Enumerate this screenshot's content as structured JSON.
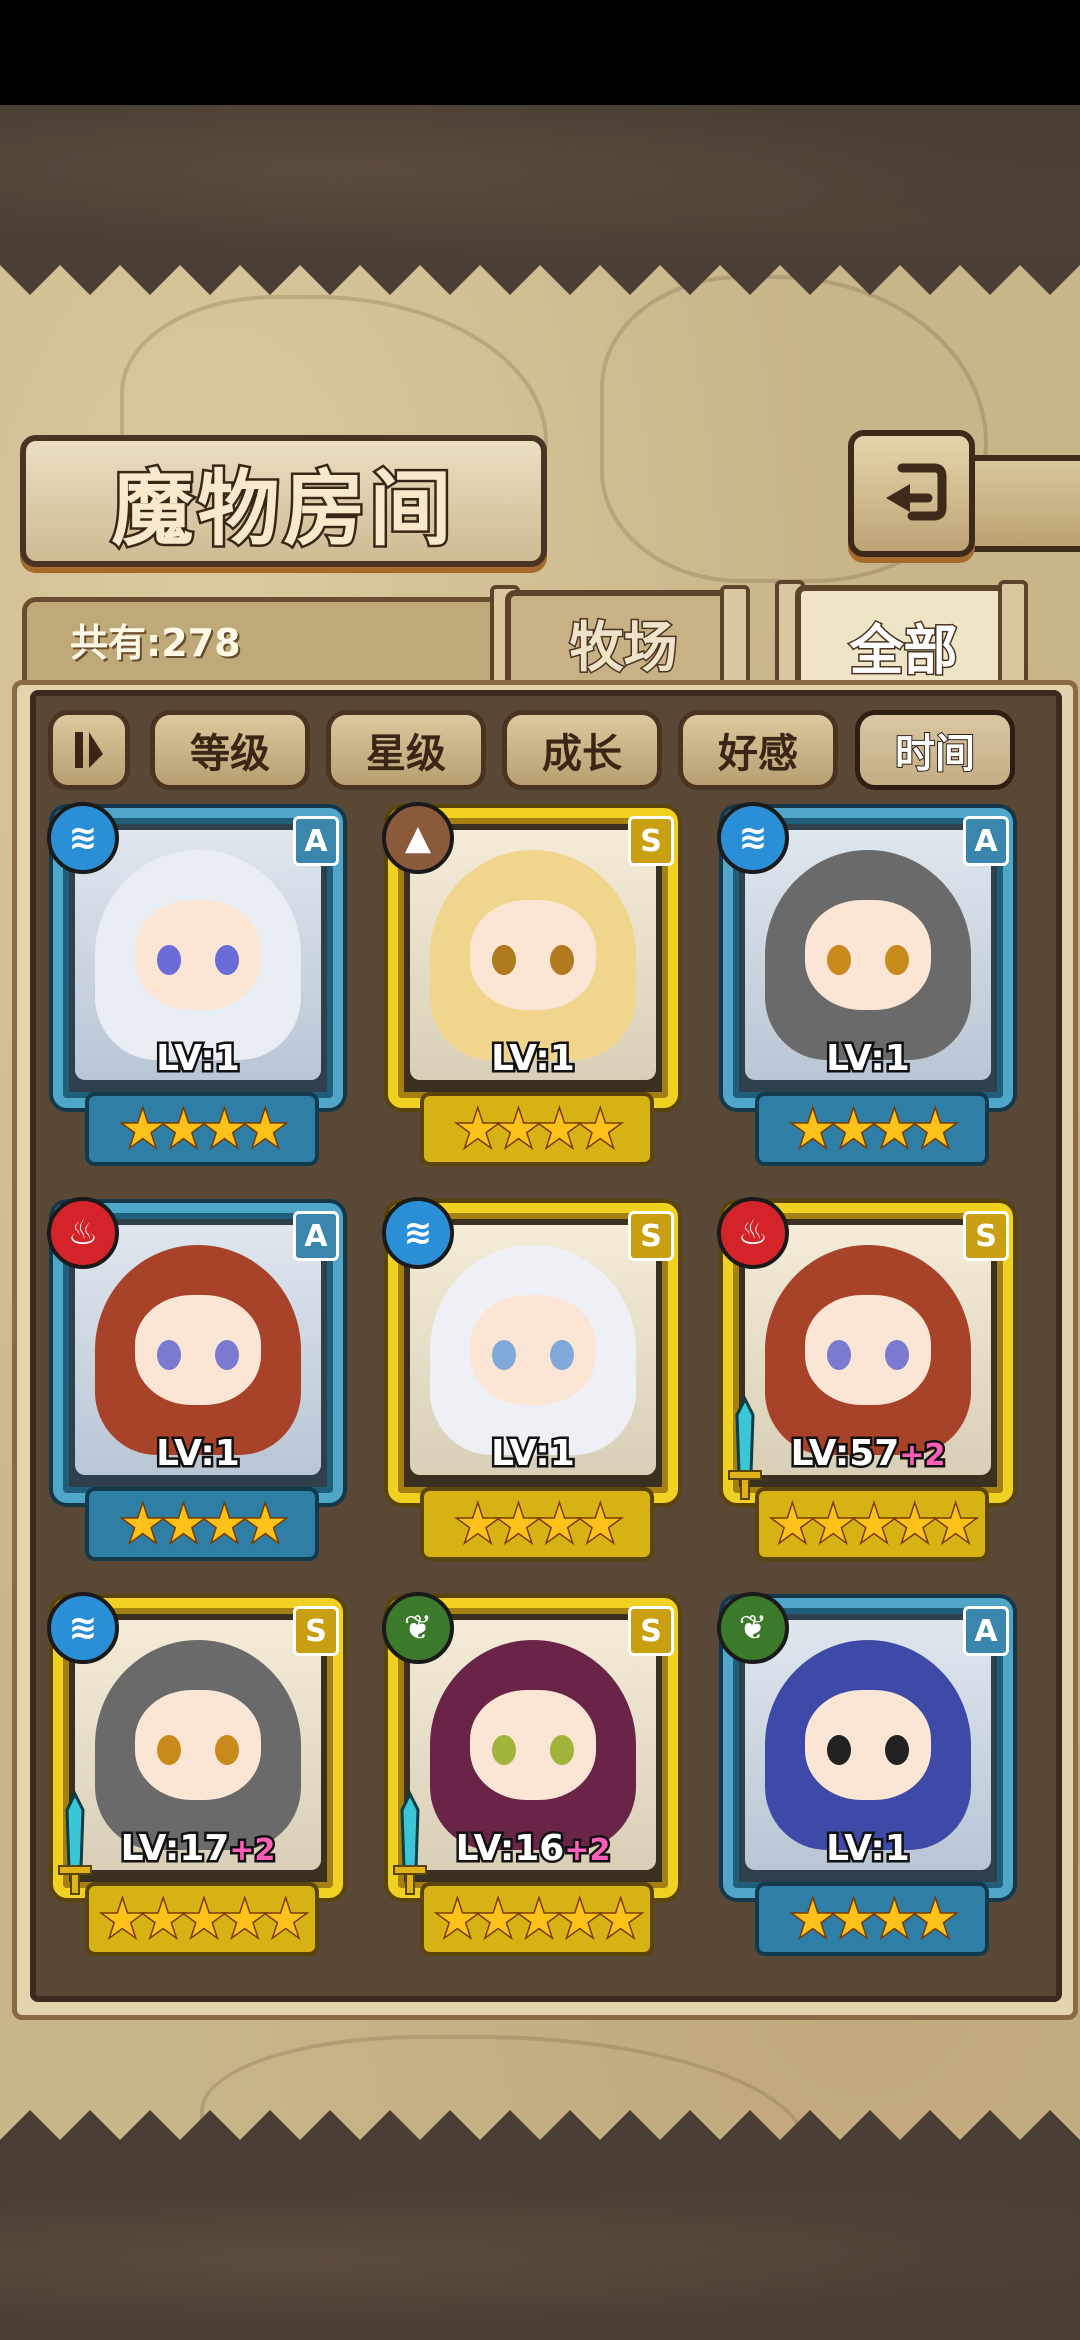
{
  "header": {
    "title": "魔物房间"
  },
  "count": {
    "text": "共有:278"
  },
  "tabs": [
    {
      "label": "牧场",
      "active": false
    },
    {
      "label": "全部",
      "active": true
    }
  ],
  "sort": [
    {
      "label": "等级",
      "active": false
    },
    {
      "label": "星级",
      "active": false
    },
    {
      "label": "成长",
      "active": false
    },
    {
      "label": "好感",
      "active": false
    },
    {
      "label": "时间",
      "active": true
    }
  ],
  "cards": [
    {
      "level": "LV:1",
      "bonus": "",
      "rank": "A",
      "element": "water",
      "frame": "blue",
      "stars": 4,
      "equip": false,
      "hair": "#e9eef5",
      "eyes": "#6a6ad8"
    },
    {
      "level": "LV:1",
      "bonus": "",
      "rank": "S",
      "element": "earth",
      "frame": "gold",
      "stars": 4,
      "equip": false,
      "hair": "#f1d58c",
      "eyes": "#b07a1e"
    },
    {
      "level": "LV:1",
      "bonus": "",
      "rank": "A",
      "element": "water",
      "frame": "blue",
      "stars": 4,
      "equip": false,
      "hair": "#6a6a6a",
      "eyes": "#c98a1c"
    },
    {
      "level": "LV:1",
      "bonus": "",
      "rank": "A",
      "element": "fire",
      "frame": "blue",
      "stars": 4,
      "equip": false,
      "hair": "#a8432a",
      "eyes": "#7a7ad0"
    },
    {
      "level": "LV:1",
      "bonus": "",
      "rank": "S",
      "element": "water",
      "frame": "gold",
      "stars": 4,
      "equip": false,
      "hair": "#eef0f6",
      "eyes": "#7fa9d9"
    },
    {
      "level": "LV:57",
      "bonus": "+2",
      "rank": "S",
      "element": "fire",
      "frame": "gold",
      "stars": 5,
      "equip": true,
      "hair": "#a8432a",
      "eyes": "#7a7ad0"
    },
    {
      "level": "LV:17",
      "bonus": "+2",
      "rank": "S",
      "element": "water",
      "frame": "gold",
      "stars": 5,
      "equip": true,
      "hair": "#6a6a6a",
      "eyes": "#c98a1c"
    },
    {
      "level": "LV:16",
      "bonus": "+2",
      "rank": "S",
      "element": "wood",
      "frame": "gold",
      "stars": 5,
      "equip": true,
      "hair": "#6a2448",
      "eyes": "#a0b33a"
    },
    {
      "level": "LV:1",
      "bonus": "",
      "rank": "A",
      "element": "wood",
      "frame": "blue",
      "stars": 4,
      "equip": false,
      "hair": "#3e4aa8",
      "eyes": "#222222"
    }
  ],
  "element_colors": {
    "water": "#2a8fd6",
    "earth": "#8a5a3a",
    "fire": "#d4242a",
    "wood": "#3a7a2a"
  },
  "element_icons": {
    "water": "water-icon",
    "earth": "mountain-icon",
    "fire": "flame-icon",
    "wood": "leaf-icon"
  }
}
